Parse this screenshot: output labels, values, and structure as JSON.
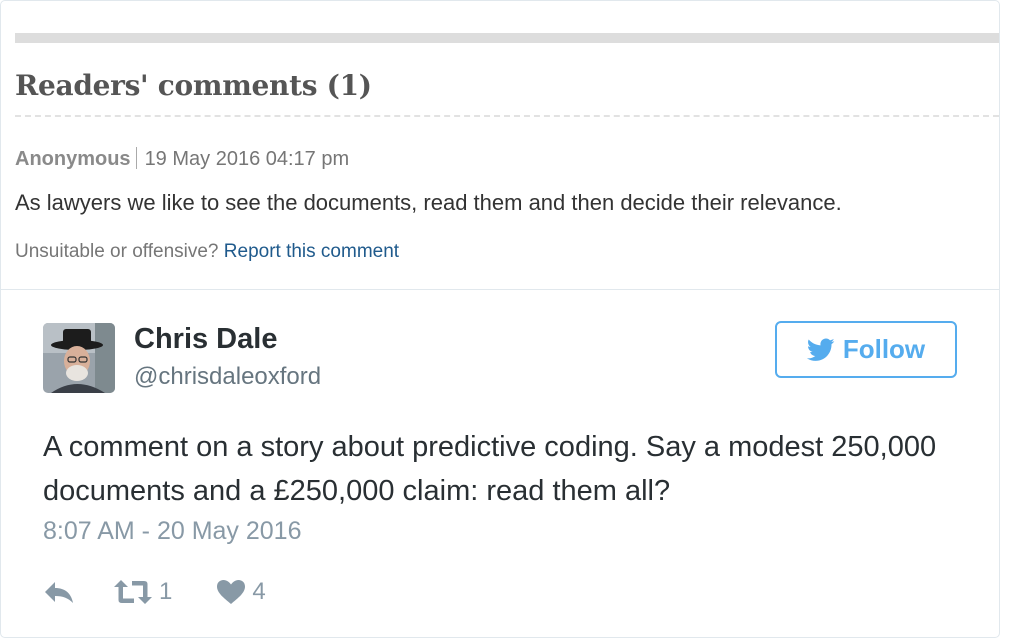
{
  "comments_section": {
    "title": "Readers' comments (1)",
    "comment": {
      "author": "Anonymous",
      "timestamp": "19 May 2016 04:17 pm",
      "body": "As lawyers we like to see the documents, read them and then decide their relevance.",
      "report_prompt": "Unsuitable or offensive?",
      "report_link": "Report this comment"
    }
  },
  "tweet": {
    "user_name": "Chris Dale",
    "user_handle": "@chrisdaleoxford",
    "follow_label": "Follow",
    "text": "A comment on a story about predictive coding. Say a modest 250,000 documents and a £250,000 claim: read them all?",
    "timestamp": "8:07 AM - 20 May 2016",
    "retweet_count": "1",
    "like_count": "4",
    "icons": {
      "follow": "twitter-bird-icon",
      "reply": "reply-icon",
      "retweet": "retweet-icon",
      "like": "heart-icon"
    }
  },
  "colors": {
    "twitter_blue": "#55acee",
    "link_blue": "#1f5a8c",
    "muted_gray": "#8899a6"
  }
}
